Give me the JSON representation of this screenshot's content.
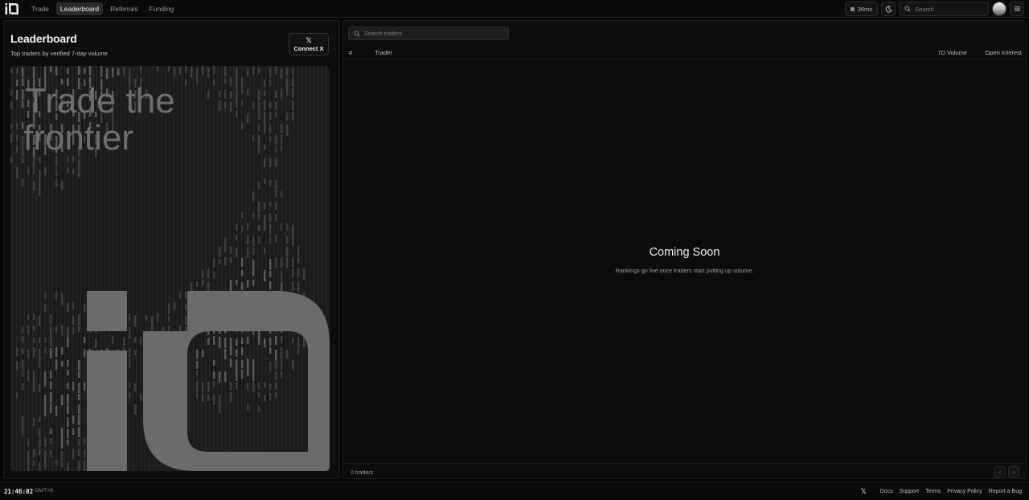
{
  "topbar": {
    "logo_alt": "iO",
    "nav": [
      {
        "label": "Trade",
        "active": false
      },
      {
        "label": "Leaderboard",
        "active": true
      },
      {
        "label": "Referrals",
        "active": false
      },
      {
        "label": "Funding",
        "active": false
      }
    ],
    "latency": "36ms",
    "theme_icon": "moon-icon",
    "search_placeholder": "Search",
    "menu_icon": "hamburger-icon"
  },
  "left": {
    "title": "Leaderboard",
    "subtitle": "Top traders by verified 7-day volume",
    "connect_label": "Connect X",
    "hero_line1": "Trade the",
    "hero_line2": "frontier"
  },
  "right": {
    "search_placeholder": "Search traders",
    "columns": {
      "rank": "#",
      "trader": "Trader",
      "volume": "7D Volume",
      "open_interest": "Open Interest"
    },
    "empty_title": "Coming Soon",
    "empty_subtitle": "Rankings go live once traders start putting up volume.",
    "count": "0 traders"
  },
  "status": {
    "time": "21:46:02",
    "timezone": "GMT+9",
    "links": [
      "Docs",
      "Support",
      "Terms",
      "Privacy Policy",
      "Report a Bug"
    ]
  },
  "colors": {
    "background": "#050505",
    "panel": "#0d0d0d",
    "accent": "#f2f2f2",
    "hero_logo": "#6b6b6b"
  }
}
